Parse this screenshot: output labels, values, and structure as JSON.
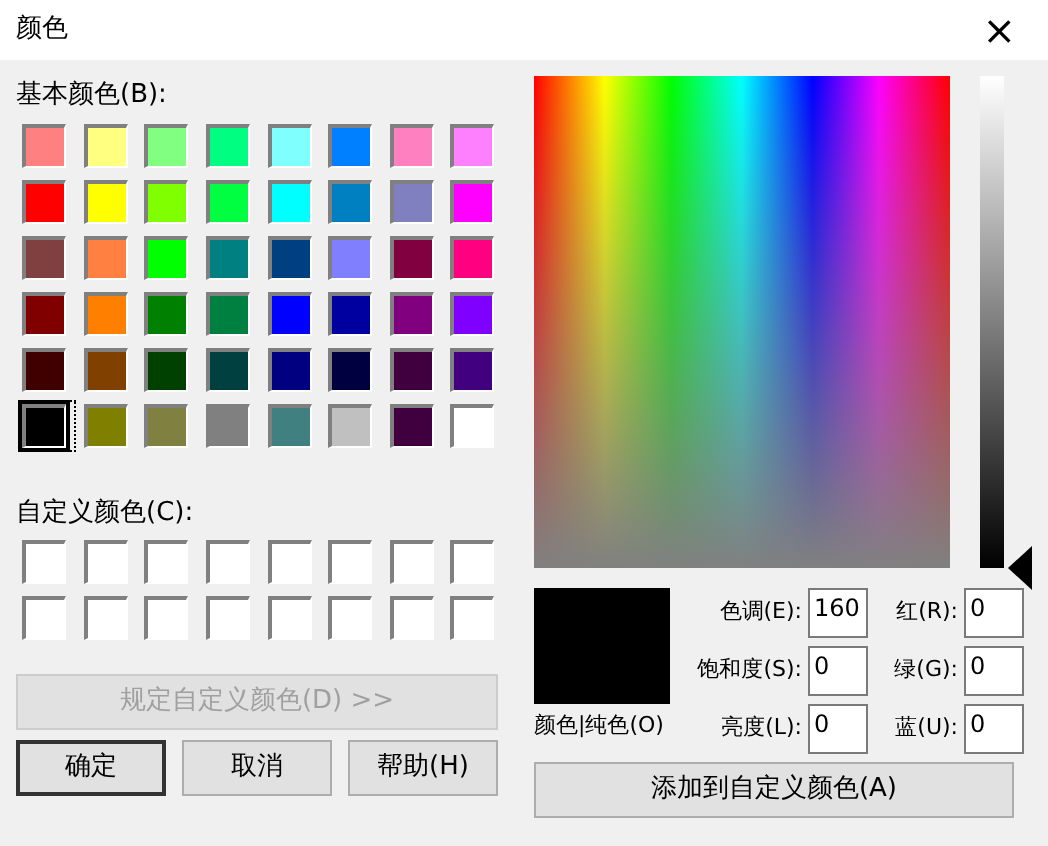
{
  "window": {
    "title": "颜色",
    "close": "×"
  },
  "basic_colors": {
    "label": "基本颜色(B):",
    "swatches": [
      {
        "color": "#ff8080",
        "selected": false
      },
      {
        "color": "#ffff80",
        "selected": false
      },
      {
        "color": "#80ff80",
        "selected": false
      },
      {
        "color": "#00ff80",
        "selected": false
      },
      {
        "color": "#80ffff",
        "selected": false
      },
      {
        "color": "#0080ff",
        "selected": false
      },
      {
        "color": "#ff80c0",
        "selected": false
      },
      {
        "color": "#ff80ff",
        "selected": false
      },
      {
        "color": "#ff0000",
        "selected": false
      },
      {
        "color": "#ffff00",
        "selected": false
      },
      {
        "color": "#80ff00",
        "selected": false
      },
      {
        "color": "#00ff40",
        "selected": false
      },
      {
        "color": "#00ffff",
        "selected": false
      },
      {
        "color": "#0080c0",
        "selected": false
      },
      {
        "color": "#8080c0",
        "selected": false
      },
      {
        "color": "#ff00ff",
        "selected": false
      },
      {
        "color": "#804040",
        "selected": false
      },
      {
        "color": "#ff8040",
        "selected": false
      },
      {
        "color": "#00ff00",
        "selected": false
      },
      {
        "color": "#008080",
        "selected": false
      },
      {
        "color": "#004080",
        "selected": false
      },
      {
        "color": "#8080ff",
        "selected": false
      },
      {
        "color": "#800040",
        "selected": false
      },
      {
        "color": "#ff0080",
        "selected": false
      },
      {
        "color": "#800000",
        "selected": false
      },
      {
        "color": "#ff8000",
        "selected": false
      },
      {
        "color": "#008000",
        "selected": false
      },
      {
        "color": "#008040",
        "selected": false
      },
      {
        "color": "#0000ff",
        "selected": false
      },
      {
        "color": "#0000a0",
        "selected": false
      },
      {
        "color": "#800080",
        "selected": false
      },
      {
        "color": "#8000ff",
        "selected": false
      },
      {
        "color": "#400000",
        "selected": false
      },
      {
        "color": "#804000",
        "selected": false
      },
      {
        "color": "#004000",
        "selected": false
      },
      {
        "color": "#004040",
        "selected": false
      },
      {
        "color": "#000080",
        "selected": false
      },
      {
        "color": "#000040",
        "selected": false
      },
      {
        "color": "#400040",
        "selected": false
      },
      {
        "color": "#400080",
        "selected": false
      },
      {
        "color": "#000000",
        "selected": true
      },
      {
        "color": "#808000",
        "selected": false
      },
      {
        "color": "#808040",
        "selected": false
      },
      {
        "color": "#808080",
        "selected": false
      },
      {
        "color": "#408080",
        "selected": false
      },
      {
        "color": "#c0c0c0",
        "selected": false
      },
      {
        "color": "#400040",
        "selected": false
      },
      {
        "color": "#ffffff",
        "selected": false
      }
    ]
  },
  "custom_colors": {
    "label": "自定义颜色(C):",
    "swatches": [
      {
        "color": "#ffffff"
      },
      {
        "color": "#ffffff"
      },
      {
        "color": "#ffffff"
      },
      {
        "color": "#ffffff"
      },
      {
        "color": "#ffffff"
      },
      {
        "color": "#ffffff"
      },
      {
        "color": "#ffffff"
      },
      {
        "color": "#ffffff"
      },
      {
        "color": "#ffffff"
      },
      {
        "color": "#ffffff"
      },
      {
        "color": "#ffffff"
      },
      {
        "color": "#ffffff"
      },
      {
        "color": "#ffffff"
      },
      {
        "color": "#ffffff"
      },
      {
        "color": "#ffffff"
      },
      {
        "color": "#ffffff"
      }
    ]
  },
  "define_button": {
    "label": "规定自定义颜色(D) >>",
    "disabled": true
  },
  "buttons": [
    {
      "label": "确定",
      "default": true
    },
    {
      "label": "取消",
      "default": false
    },
    {
      "label": "帮助(H)",
      "default": false
    }
  ],
  "preview": {
    "color": "#000000",
    "label": "颜色|纯色(O)"
  },
  "fields": [
    {
      "label": "色调(E):",
      "value": "160"
    },
    {
      "label": "红(R):",
      "value": "0"
    },
    {
      "label": "饱和度(S):",
      "value": "0"
    },
    {
      "label": "绿(G):",
      "value": "0"
    },
    {
      "label": "亮度(L):",
      "value": "0"
    },
    {
      "label": "蓝(U):",
      "value": "0"
    }
  ],
  "add_button": {
    "label": "添加到自定义颜色(A)"
  }
}
